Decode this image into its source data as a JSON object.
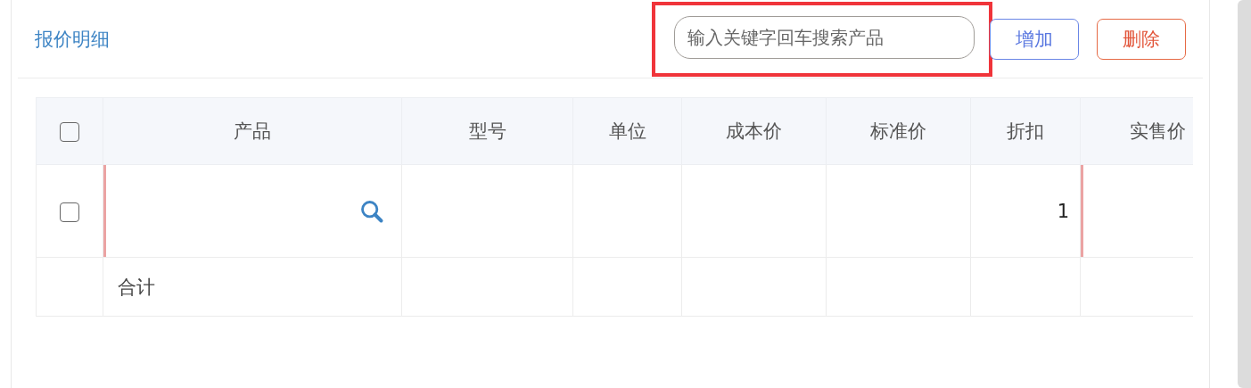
{
  "section_title": "报价明细",
  "search": {
    "placeholder": "输入关键字回车搜索产品",
    "highlighted": true
  },
  "buttons": [
    {
      "label": "增加",
      "kind": "add"
    },
    {
      "label": "删除",
      "kind": "delete"
    }
  ],
  "table": {
    "select_all": {
      "checked": false
    },
    "columns": [
      "产品",
      "型号",
      "单位",
      "成本价",
      "标准价",
      "折扣",
      "实售价"
    ],
    "rows": [
      {
        "checked": false,
        "cells": [
          {
            "text": "",
            "kind": "search",
            "marked": true
          },
          {
            "text": "",
            "kind": "text",
            "marked": false
          },
          {
            "text": "",
            "kind": "text",
            "marked": false
          },
          {
            "text": "",
            "kind": "text",
            "marked": false
          },
          {
            "text": "",
            "kind": "text",
            "marked": false
          },
          {
            "text": "1",
            "kind": "number",
            "marked": false
          },
          {
            "text": "",
            "kind": "text",
            "marked": true
          }
        ]
      }
    ],
    "summary": {
      "label": "合计"
    }
  }
}
